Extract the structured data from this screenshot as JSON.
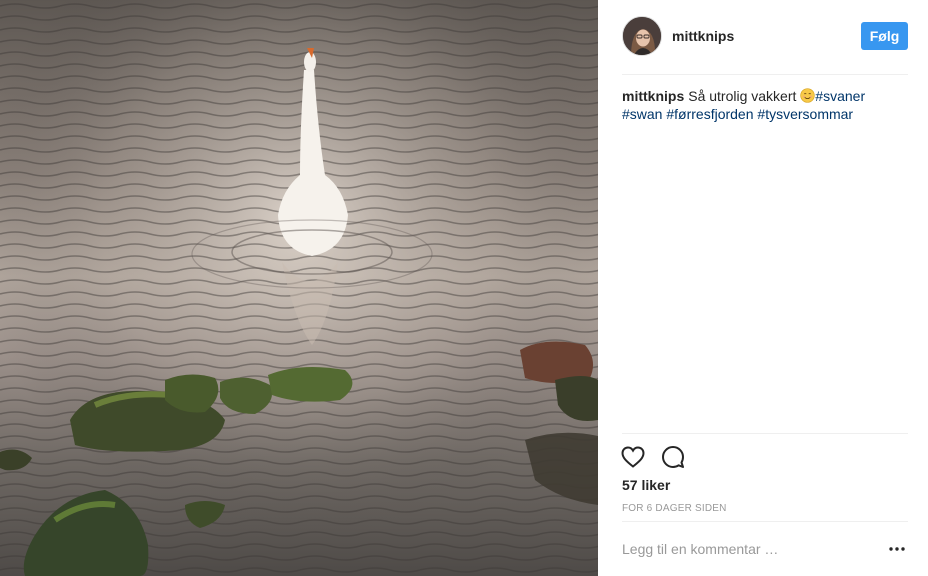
{
  "post": {
    "photo_alt": "swan on water",
    "author": {
      "username": "mittknips",
      "avatar_icon": "user-avatar"
    },
    "follow_label": "Følg",
    "caption": {
      "author": "mittknips",
      "text": "Så utrolig vakkert",
      "emoji_icon": "smiling-face-icon",
      "hashtags": [
        "#svaner",
        "#swan",
        "#førresfjorden",
        "#tysversommar"
      ]
    },
    "likes": "57 liker",
    "timestamp": "FOR 6 DAGER SIDEN",
    "comment_placeholder": "Legg til en kommentar …",
    "colors": {
      "accent": "#3897f0",
      "hashtag": "#003569",
      "muted": "#999999",
      "divider": "#efefef"
    },
    "icons": [
      "heart-icon",
      "comment-icon",
      "more-options-icon"
    ]
  }
}
